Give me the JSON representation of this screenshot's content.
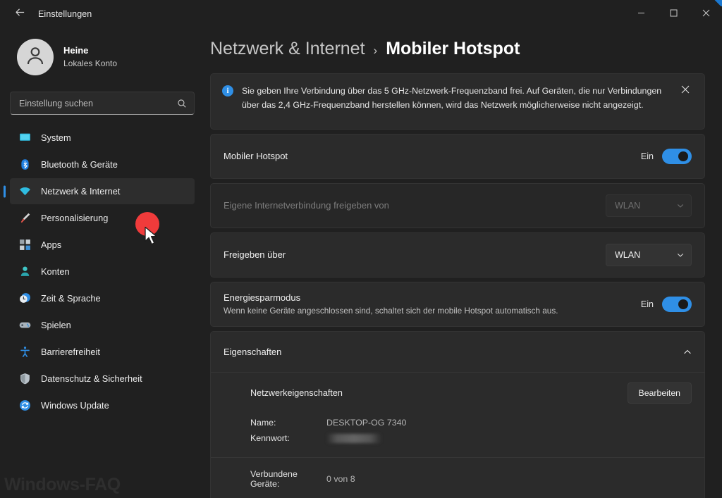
{
  "window": {
    "title": "Einstellungen",
    "back_icon": "back-arrow-icon",
    "minimize_label": "Minimieren",
    "maximize_label": "Maximieren",
    "close_label": "Schließen"
  },
  "account": {
    "name": "Heine",
    "type": "Lokales Konto",
    "avatar_icon": "person-avatar-icon"
  },
  "search": {
    "placeholder": "Einstellung suchen",
    "value": "",
    "icon": "search-icon"
  },
  "sidebar": {
    "items": [
      {
        "label": "System",
        "icon": "monitor-icon",
        "selected": false
      },
      {
        "label": "Bluetooth & Geräte",
        "icon": "bluetooth-icon",
        "selected": false
      },
      {
        "label": "Netzwerk & Internet",
        "icon": "wifi-icon",
        "selected": true
      },
      {
        "label": "Personalisierung",
        "icon": "paintbrush-icon",
        "selected": false
      },
      {
        "label": "Apps",
        "icon": "apps-grid-icon",
        "selected": false
      },
      {
        "label": "Konten",
        "icon": "accounts-person-icon",
        "selected": false
      },
      {
        "label": "Zeit & Sprache",
        "icon": "clock-globe-icon",
        "selected": false
      },
      {
        "label": "Spielen",
        "icon": "gamepad-icon",
        "selected": false
      },
      {
        "label": "Barrierefreiheit",
        "icon": "accessibility-person-icon",
        "selected": false
      },
      {
        "label": "Datenschutz & Sicherheit",
        "icon": "shield-icon",
        "selected": false
      },
      {
        "label": "Windows Update",
        "icon": "update-refresh-icon",
        "selected": false
      }
    ]
  },
  "breadcrumb": {
    "parent": "Netzwerk & Internet",
    "separator": "›",
    "current": "Mobiler Hotspot"
  },
  "banner": {
    "icon": "info-icon",
    "glyph": "i",
    "text": "Sie geben Ihre Verbindung über das 5 GHz-Netzwerk-Frequenzband frei. Auf Geräten, die nur Verbindungen über das 2,4 GHz-Frequenzband herstellen können, wird das Netzwerk möglicherweise nicht angezeigt.",
    "close_icon": "close-icon"
  },
  "hotspot": {
    "label": "Mobiler Hotspot",
    "state": "Ein",
    "enabled": true
  },
  "share_from": {
    "label": "Eigene Internetverbindung freigeben von",
    "value": "WLAN",
    "disabled": true,
    "chevron_icon": "chevron-down-icon"
  },
  "share_over": {
    "label": "Freigeben über",
    "value": "WLAN",
    "disabled": false,
    "chevron_icon": "chevron-down-icon"
  },
  "power_saving": {
    "label": "Energiesparmodus",
    "description": "Wenn keine Geräte angeschlossen sind, schaltet sich der mobile Hotspot automatisch aus.",
    "state": "Ein",
    "enabled": true
  },
  "properties": {
    "header": "Eigenschaften",
    "expanded": true,
    "chevron_icon": "chevron-up-icon",
    "network_properties_label": "Netzwerkeigenschaften",
    "edit_button": "Bearbeiten",
    "fields": [
      {
        "key": "Name:",
        "value": "DESKTOP-OG 7340",
        "redacted": false
      },
      {
        "key": "Kennwort:",
        "value": "",
        "redacted": true
      }
    ],
    "connected_devices": {
      "key": "Verbundene Geräte:",
      "value": "0 von 8"
    }
  },
  "watermark": {
    "text": "Windows-FAQ"
  },
  "colors": {
    "accent": "#2f8fe6",
    "page_background": "#202020",
    "card_background": "#2b2b2b",
    "click_marker": "#f03b3b"
  }
}
